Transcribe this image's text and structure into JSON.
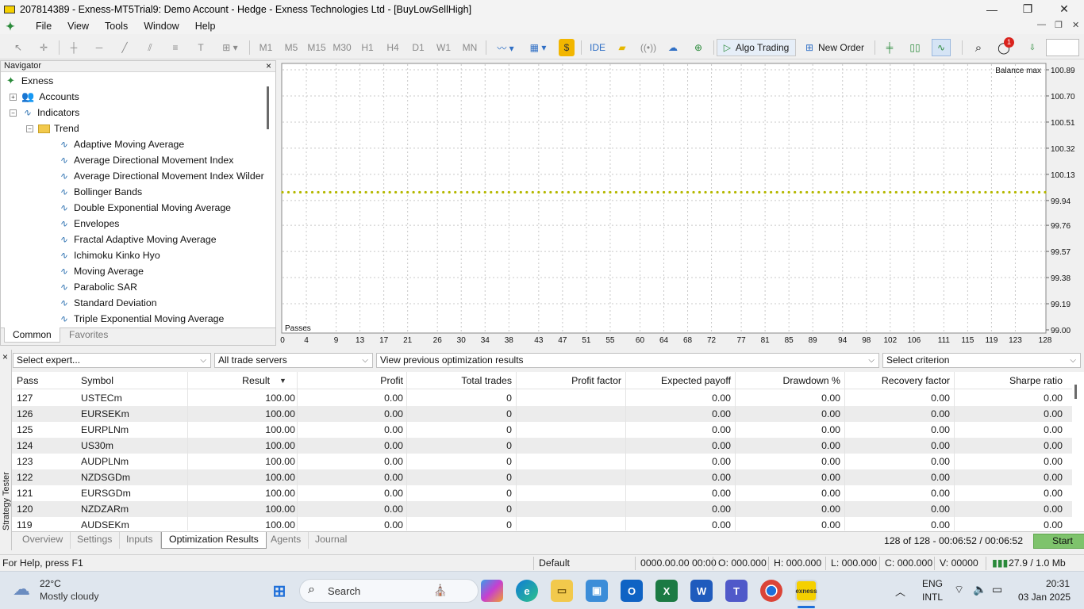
{
  "window": {
    "title": "207814389 - Exness-MT5Trial9: Demo Account - Hedge - Exness Technologies Ltd - [BuyLowSellHigh]",
    "controls": [
      "—",
      "❐",
      "✕"
    ]
  },
  "menu": {
    "items": [
      "File",
      "View",
      "Tools",
      "Window",
      "Help"
    ]
  },
  "toolbar": {
    "timeframes": [
      "M1",
      "M5",
      "M15",
      "M30",
      "H1",
      "H4",
      "D1",
      "W1",
      "MN"
    ],
    "ide": "IDE",
    "algo_trading": "Algo Trading",
    "new_order": "New Order",
    "notification_count": "1",
    "dollar": "$"
  },
  "navigator": {
    "title": "Navigator",
    "close": "×",
    "root": "Exness",
    "accounts": "Accounts",
    "indicators": "Indicators",
    "trend": "Trend",
    "trend_items": [
      "Adaptive Moving Average",
      "Average Directional Movement Index",
      "Average Directional Movement Index Wilder",
      "Bollinger Bands",
      "Double Exponential Moving Average",
      "Envelopes",
      "Fractal Adaptive Moving Average",
      "Ichimoku Kinko Hyo",
      "Moving Average",
      "Parabolic SAR",
      "Standard Deviation",
      "Triple Exponential Moving Average"
    ],
    "tabs": [
      "Common",
      "Favorites"
    ]
  },
  "chart_data": {
    "type": "scatter",
    "title": "Balance max",
    "xlabel": "Passes",
    "ylabel": "",
    "x_ticks": [
      0,
      4,
      9,
      13,
      17,
      21,
      26,
      30,
      34,
      38,
      43,
      47,
      51,
      55,
      60,
      64,
      68,
      72,
      77,
      81,
      85,
      89,
      94,
      98,
      102,
      106,
      111,
      115,
      119,
      123,
      128
    ],
    "y_ticks": [
      "100.89",
      "100.70",
      "100.51",
      "100.32",
      "100.13",
      "99.94",
      "99.76",
      "99.57",
      "99.38",
      "99.19",
      "99.00"
    ],
    "xlim": [
      0,
      128
    ],
    "ylim": [
      99.0,
      100.89
    ],
    "series": [
      {
        "color": "#b5b800",
        "point_count": 128,
        "y_value": 100.0
      }
    ]
  },
  "tester": {
    "close": "×",
    "side_label": "Strategy Tester",
    "select_expert": "Select expert...",
    "trade_servers": "All trade servers",
    "view_previous": "View previous optimization results",
    "select_criterion": "Select criterion",
    "columns": [
      "Pass",
      "Symbol",
      "Result",
      "Profit",
      "Total trades",
      "Profit factor",
      "Expected payoff",
      "Drawdown %",
      "Recovery factor",
      "Sharpe ratio"
    ],
    "sort_indicator": "▼",
    "rows": [
      [
        "127",
        "USTECm",
        "100.00",
        "0.00",
        "0",
        "",
        "0.00",
        "0.00",
        "0.00",
        "0.00"
      ],
      [
        "126",
        "EURSEKm",
        "100.00",
        "0.00",
        "0",
        "",
        "0.00",
        "0.00",
        "0.00",
        "0.00"
      ],
      [
        "125",
        "EURPLNm",
        "100.00",
        "0.00",
        "0",
        "",
        "0.00",
        "0.00",
        "0.00",
        "0.00"
      ],
      [
        "124",
        "US30m",
        "100.00",
        "0.00",
        "0",
        "",
        "0.00",
        "0.00",
        "0.00",
        "0.00"
      ],
      [
        "123",
        "AUDPLNm",
        "100.00",
        "0.00",
        "0",
        "",
        "0.00",
        "0.00",
        "0.00",
        "0.00"
      ],
      [
        "122",
        "NZDSGDm",
        "100.00",
        "0.00",
        "0",
        "",
        "0.00",
        "0.00",
        "0.00",
        "0.00"
      ],
      [
        "121",
        "EURSGDm",
        "100.00",
        "0.00",
        "0",
        "",
        "0.00",
        "0.00",
        "0.00",
        "0.00"
      ],
      [
        "120",
        "NZDZARm",
        "100.00",
        "0.00",
        "0",
        "",
        "0.00",
        "0.00",
        "0.00",
        "0.00"
      ],
      [
        "119",
        "AUDSEKm",
        "100.00",
        "0.00",
        "0",
        "",
        "0.00",
        "0.00",
        "0.00",
        "0.00"
      ]
    ],
    "tabs": [
      "Overview",
      "Settings",
      "Inputs",
      "Optimization Results",
      "Agents",
      "Journal"
    ],
    "progress": "128 of 128  -  00:06:52 / 00:06:52",
    "start": "Start"
  },
  "status": {
    "help": "For Help, press F1",
    "profile": "Default",
    "time": "0000.00.00 00:00",
    "open": "O: 000.000",
    "high": "H: 000.000",
    "low": "L: 000.000",
    "close": "C: 000.000",
    "volume": "V: 00000",
    "traffic": "27.9 / 1.0 Mb"
  },
  "taskbar": {
    "temp": "22°C",
    "weather": "Mostly cloudy",
    "search": "Search",
    "lang1": "ENG",
    "lang2": "INTL",
    "time": "20:31",
    "date": "03 Jan 2025"
  }
}
